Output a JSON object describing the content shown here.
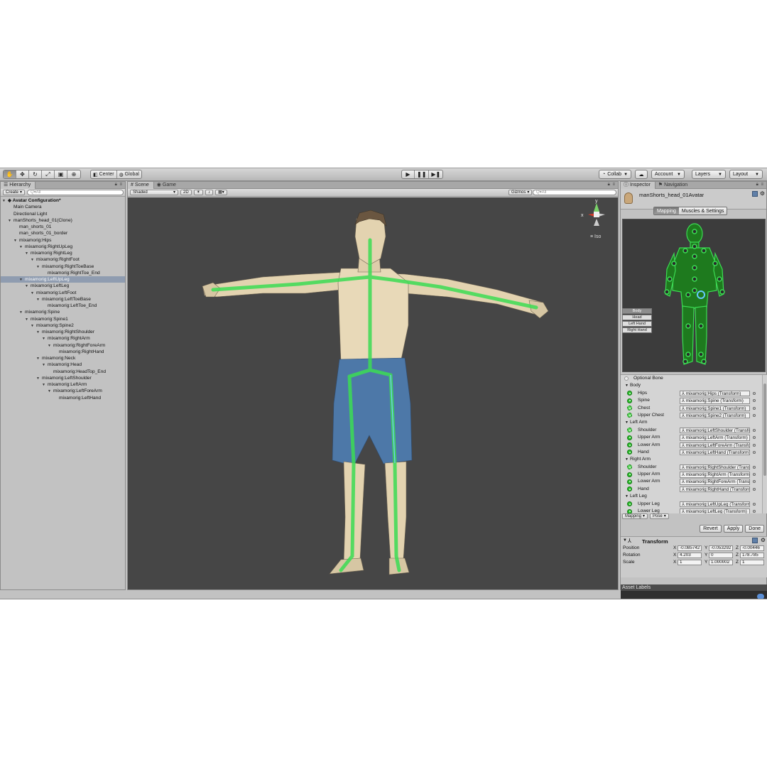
{
  "toolbar": {
    "pivot": "Center",
    "space": "Global",
    "collab": "Collab",
    "account": "Account",
    "layers": "Layers",
    "layout": "Layout"
  },
  "hierarchy": {
    "tab": "Hierarchy",
    "create": "Create",
    "search_placeholder": "Q▾All",
    "items": [
      {
        "label": "Avatar Configuration*",
        "indent": 0,
        "arrow": true,
        "root": true
      },
      {
        "label": "Main Camera",
        "indent": 1,
        "arrow": false
      },
      {
        "label": "Directional Light",
        "indent": 1,
        "arrow": false
      },
      {
        "label": "manShorts_head_01(Clone)",
        "indent": 1,
        "arrow": true
      },
      {
        "label": "man_shorts_01",
        "indent": 2,
        "arrow": false
      },
      {
        "label": "man_shorts_01_border",
        "indent": 2,
        "arrow": false
      },
      {
        "label": "mixamorig:Hips",
        "indent": 2,
        "arrow": true
      },
      {
        "label": "mixamorig:RightUpLeg",
        "indent": 3,
        "arrow": true
      },
      {
        "label": "mixamorig:RightLeg",
        "indent": 4,
        "arrow": true
      },
      {
        "label": "mixamorig:RightFoot",
        "indent": 5,
        "arrow": true
      },
      {
        "label": "mixamorig:RightToeBase",
        "indent": 6,
        "arrow": true
      },
      {
        "label": "mixamorig:RightToe_End",
        "indent": 7,
        "arrow": false
      },
      {
        "label": "mixamorig:LeftUpLeg",
        "indent": 3,
        "arrow": true,
        "selected": true
      },
      {
        "label": "mixamorig:LeftLeg",
        "indent": 4,
        "arrow": true
      },
      {
        "label": "mixamorig:LeftFoot",
        "indent": 5,
        "arrow": true
      },
      {
        "label": "mixamorig:LeftToeBase",
        "indent": 6,
        "arrow": true
      },
      {
        "label": "mixamorig:LeftToe_End",
        "indent": 7,
        "arrow": false
      },
      {
        "label": "mixamorig:Spine",
        "indent": 3,
        "arrow": true
      },
      {
        "label": "mixamorig:Spine1",
        "indent": 4,
        "arrow": true
      },
      {
        "label": "mixamorig:Spine2",
        "indent": 5,
        "arrow": true
      },
      {
        "label": "mixamorig:RightShoulder",
        "indent": 6,
        "arrow": true
      },
      {
        "label": "mixamorig:RightArm",
        "indent": 7,
        "arrow": true
      },
      {
        "label": "mixamorig:RightForeArm",
        "indent": 8,
        "arrow": true
      },
      {
        "label": "mixamorig:RightHand",
        "indent": 9,
        "arrow": false
      },
      {
        "label": "mixamorig:Neck",
        "indent": 6,
        "arrow": true
      },
      {
        "label": "mixamorig:Head",
        "indent": 7,
        "arrow": true
      },
      {
        "label": "mixamorig:HeadTop_End",
        "indent": 8,
        "arrow": false
      },
      {
        "label": "mixamorig:LeftShoulder",
        "indent": 6,
        "arrow": true
      },
      {
        "label": "mixamorig:LeftArm",
        "indent": 7,
        "arrow": true
      },
      {
        "label": "mixamorig:LeftForeArm",
        "indent": 8,
        "arrow": true
      },
      {
        "label": "mixamorig:LeftHand",
        "indent": 9,
        "arrow": false
      }
    ]
  },
  "scene": {
    "tab_scene": "Scene",
    "tab_game": "Game",
    "shading": "Shaded",
    "mode_2d": "2D",
    "gizmos": "Gizmos",
    "search_placeholder": "Q▾All",
    "gizmo_x": "x",
    "gizmo_y": "y",
    "gizmo_label": "Iso"
  },
  "inspector": {
    "tab": "Inspector",
    "tab_nav": "Navigation",
    "asset_name": "manShorts_head_01Avatar",
    "mode_mapping": "Mapping",
    "mode_muscles": "Muscles & Settings",
    "parts": [
      "Body",
      "Head",
      "Left Hand",
      "Right Hand"
    ],
    "optional_bone": "Optional Bone",
    "bones": [
      {
        "type": "header",
        "label": "Body"
      },
      {
        "type": "bone",
        "label": "Hips",
        "value": "mixamorig:Hips (Transform)"
      },
      {
        "type": "bone",
        "label": "Spine",
        "value": "mixamorig:Spine (Transform)"
      },
      {
        "type": "bone",
        "label": "Chest",
        "value": "mixamorig:Spine1 (Transform)",
        "dash": true
      },
      {
        "type": "bone",
        "label": "Upper Chest",
        "value": "mixamorig:Spine2 (Transform)",
        "dash": true
      },
      {
        "type": "header",
        "label": "Left Arm"
      },
      {
        "type": "bone",
        "label": "Shoulder",
        "value": "mixamorig:LeftShoulder (Transform)",
        "dash": true
      },
      {
        "type": "bone",
        "label": "Upper Arm",
        "value": "mixamorig:LeftArm (Transform)"
      },
      {
        "type": "bone",
        "label": "Lower Arm",
        "value": "mixamorig:LeftForeArm (Transform)"
      },
      {
        "type": "bone",
        "label": "Hand",
        "value": "mixamorig:LeftHand (Transform)"
      },
      {
        "type": "header",
        "label": "Right Arm"
      },
      {
        "type": "bone",
        "label": "Shoulder",
        "value": "mixamorig:RightShoulder (Transform)",
        "dash": true
      },
      {
        "type": "bone",
        "label": "Upper Arm",
        "value": "mixamorig:RightArm (Transform)"
      },
      {
        "type": "bone",
        "label": "Lower Arm",
        "value": "mixamorig:RightForeArm (Transform)"
      },
      {
        "type": "bone",
        "label": "Hand",
        "value": "mixamorig:RightHand (Transform)"
      },
      {
        "type": "header",
        "label": "Left Leg"
      },
      {
        "type": "bone",
        "label": "Upper Leg",
        "value": "mixamorig:LeftUpLeg (Transform)"
      },
      {
        "type": "bone",
        "label": "Lower Leg",
        "value": "mixamorig:LeftLeg (Transform)"
      }
    ],
    "mapping_drop": "Mapping",
    "pose_drop": "Pose",
    "revert": "Revert",
    "apply": "Apply",
    "done": "Done",
    "transform": {
      "title": "Transform",
      "position_label": "Position",
      "rotation_label": "Rotation",
      "scale_label": "Scale",
      "position": [
        "-0.085742",
        "-0.053292",
        "-0.00446"
      ],
      "rotation": [
        "4.203",
        "0",
        "178.785"
      ],
      "scale": [
        "1",
        "1.000002",
        "1"
      ]
    },
    "asset_labels": "Asset Labels"
  },
  "colors": {
    "bone_green": "#3cdc54",
    "skin": "#e6d6b5",
    "shorts": "#4d78a8",
    "viewport_bg": "#464646",
    "selection": "#8f9cb0"
  }
}
